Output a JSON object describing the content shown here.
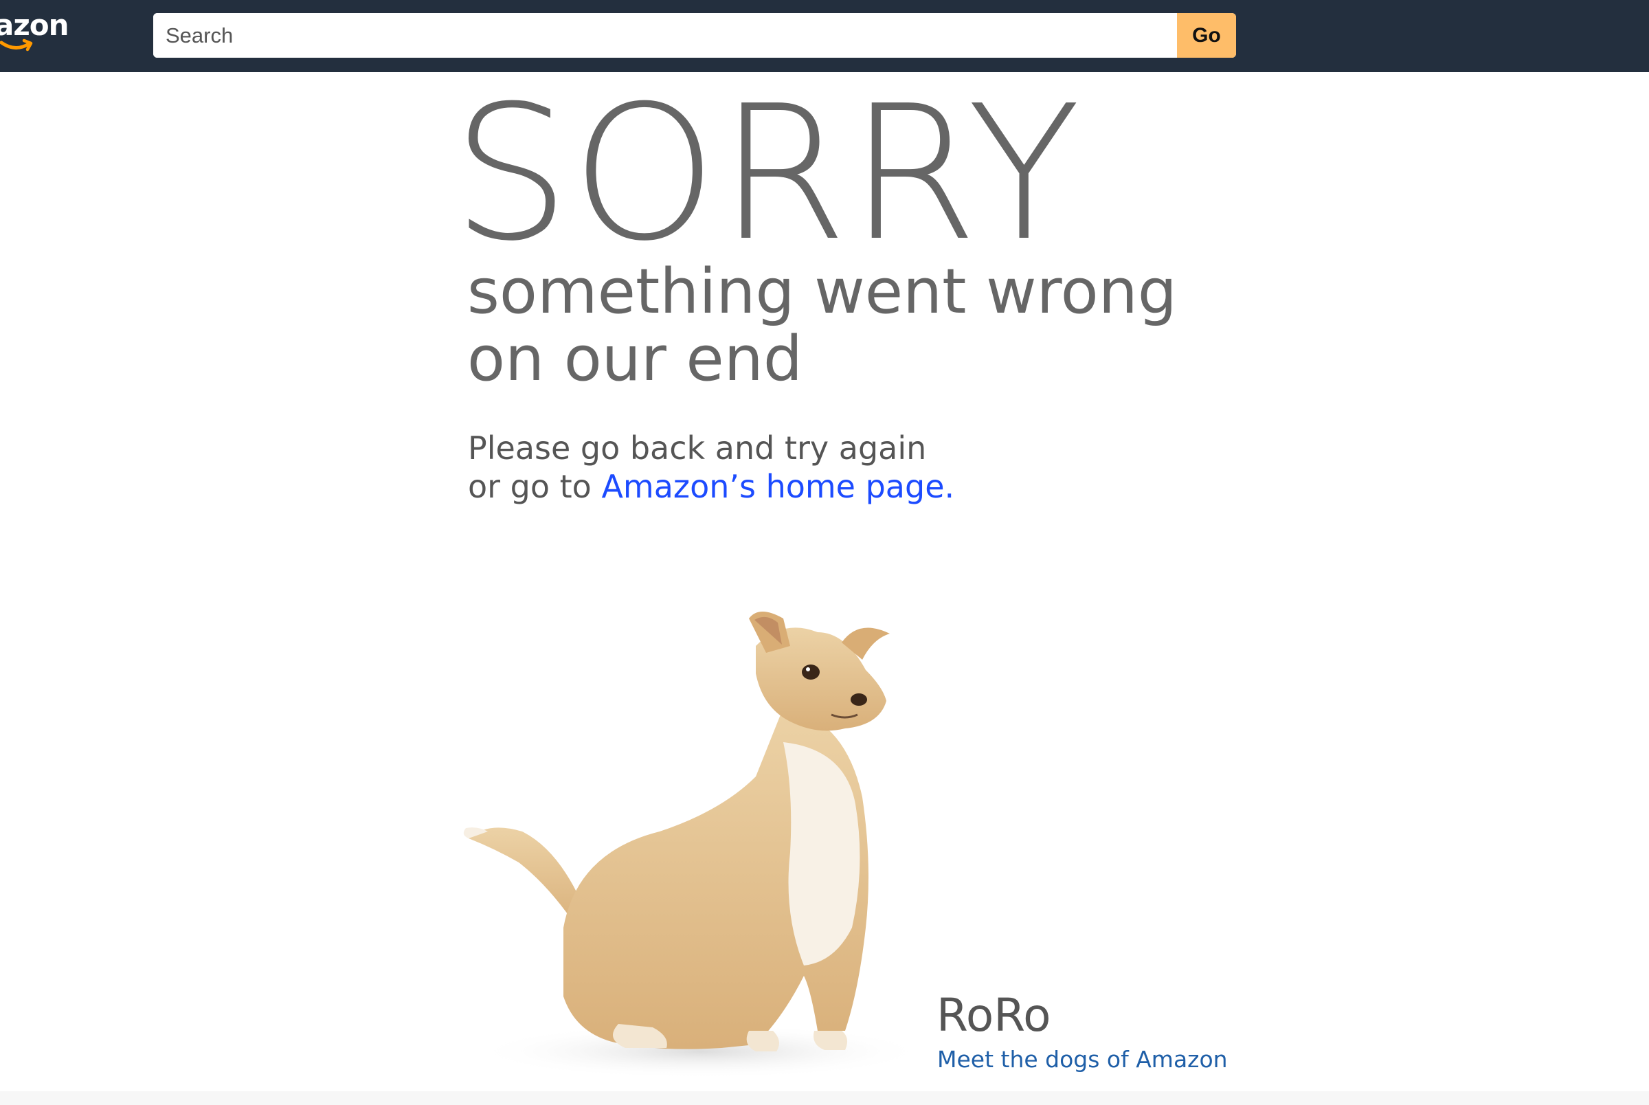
{
  "header": {
    "logo_text": "azon",
    "search": {
      "placeholder": "Search",
      "value": ""
    },
    "go_label": "Go"
  },
  "main": {
    "title": "SORRY",
    "subtitle_line1": "something went wrong",
    "subtitle_line2": "on our end",
    "help_line1": "Please go back and try again",
    "help_line2_prefix": "or go to ",
    "home_link_text": "Amazon’s home page.",
    "dog": {
      "name": "RoRo",
      "link_text": "Meet the dogs of Amazon"
    }
  },
  "colors": {
    "header_bg": "#232f3e",
    "go_button": "#febd69",
    "link": "#1c4bff",
    "dogs_link": "#1f5fa8",
    "text_gray": "#666666"
  }
}
